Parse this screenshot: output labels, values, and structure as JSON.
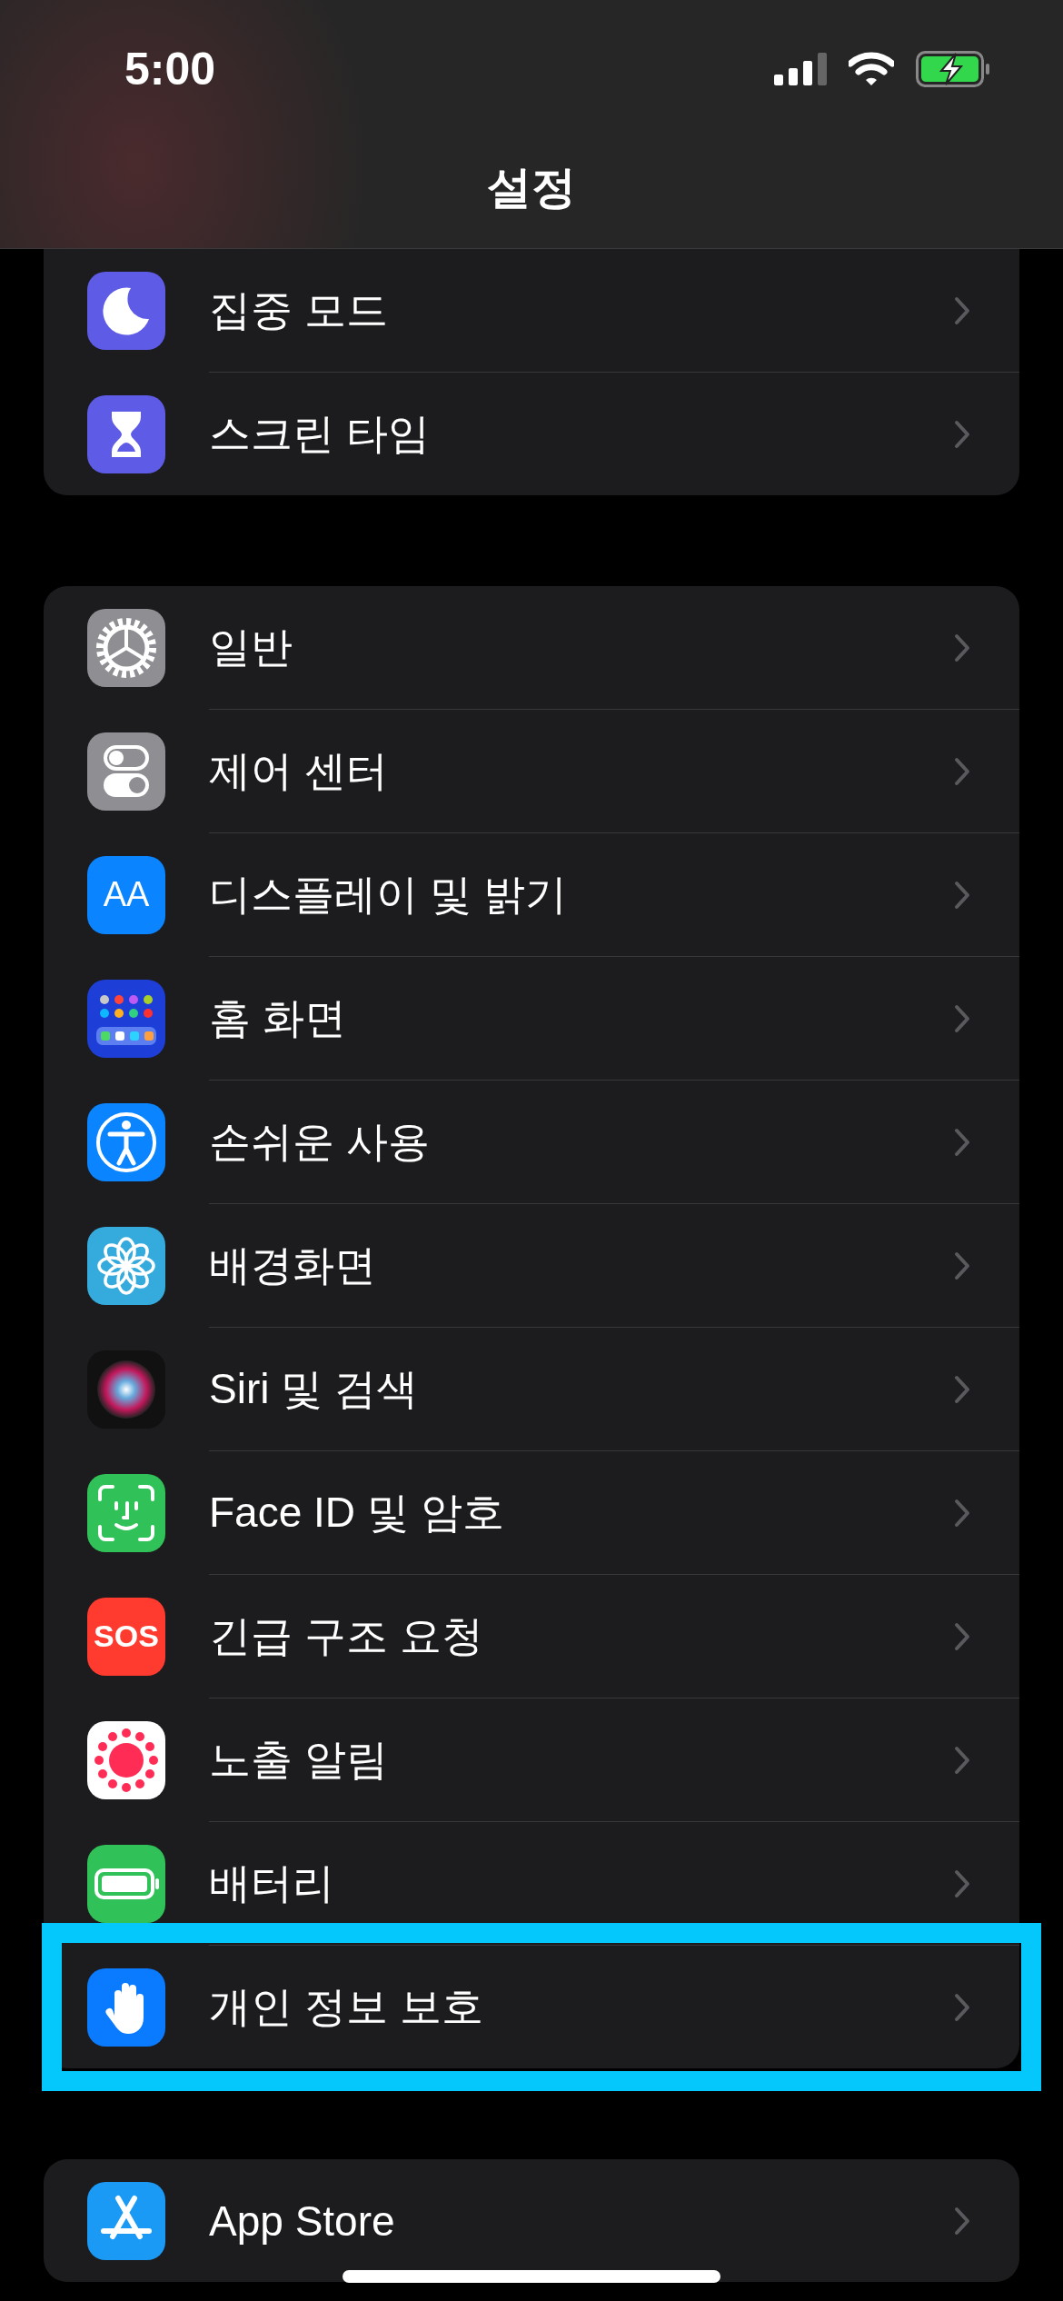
{
  "status_bar": {
    "time": "5:00"
  },
  "title": "설정",
  "groups": [
    {
      "items": [
        {
          "label": "집중 모드",
          "kind": "focus",
          "highlighted": false
        },
        {
          "label": "스크린 타임",
          "kind": "screen_time",
          "highlighted": false
        }
      ]
    },
    {
      "items": [
        {
          "label": "일반",
          "kind": "general",
          "highlighted": false
        },
        {
          "label": "제어 센터",
          "kind": "control_center",
          "highlighted": false
        },
        {
          "label": "디스플레이 및 밝기",
          "kind": "display",
          "icon_text": "AA",
          "highlighted": false
        },
        {
          "label": "홈 화면",
          "kind": "home",
          "highlighted": false
        },
        {
          "label": "손쉬운 사용",
          "kind": "accessibility",
          "highlighted": false
        },
        {
          "label": "배경화면",
          "kind": "wallpaper",
          "highlighted": false
        },
        {
          "label": "Siri 및 검색",
          "kind": "siri",
          "highlighted": false
        },
        {
          "label": "Face ID 및 암호",
          "kind": "faceid",
          "highlighted": false
        },
        {
          "label": "긴급 구조 요청",
          "kind": "sos",
          "icon_text": "SOS",
          "highlighted": false
        },
        {
          "label": "노출 알림",
          "kind": "exposure",
          "highlighted": false
        },
        {
          "label": "배터리",
          "kind": "battery",
          "highlighted": false
        },
        {
          "label": "개인 정보 보호",
          "kind": "privacy",
          "highlighted": true
        }
      ]
    },
    {
      "items": [
        {
          "label": "App Store",
          "kind": "appstore",
          "highlighted": false
        }
      ]
    }
  ]
}
